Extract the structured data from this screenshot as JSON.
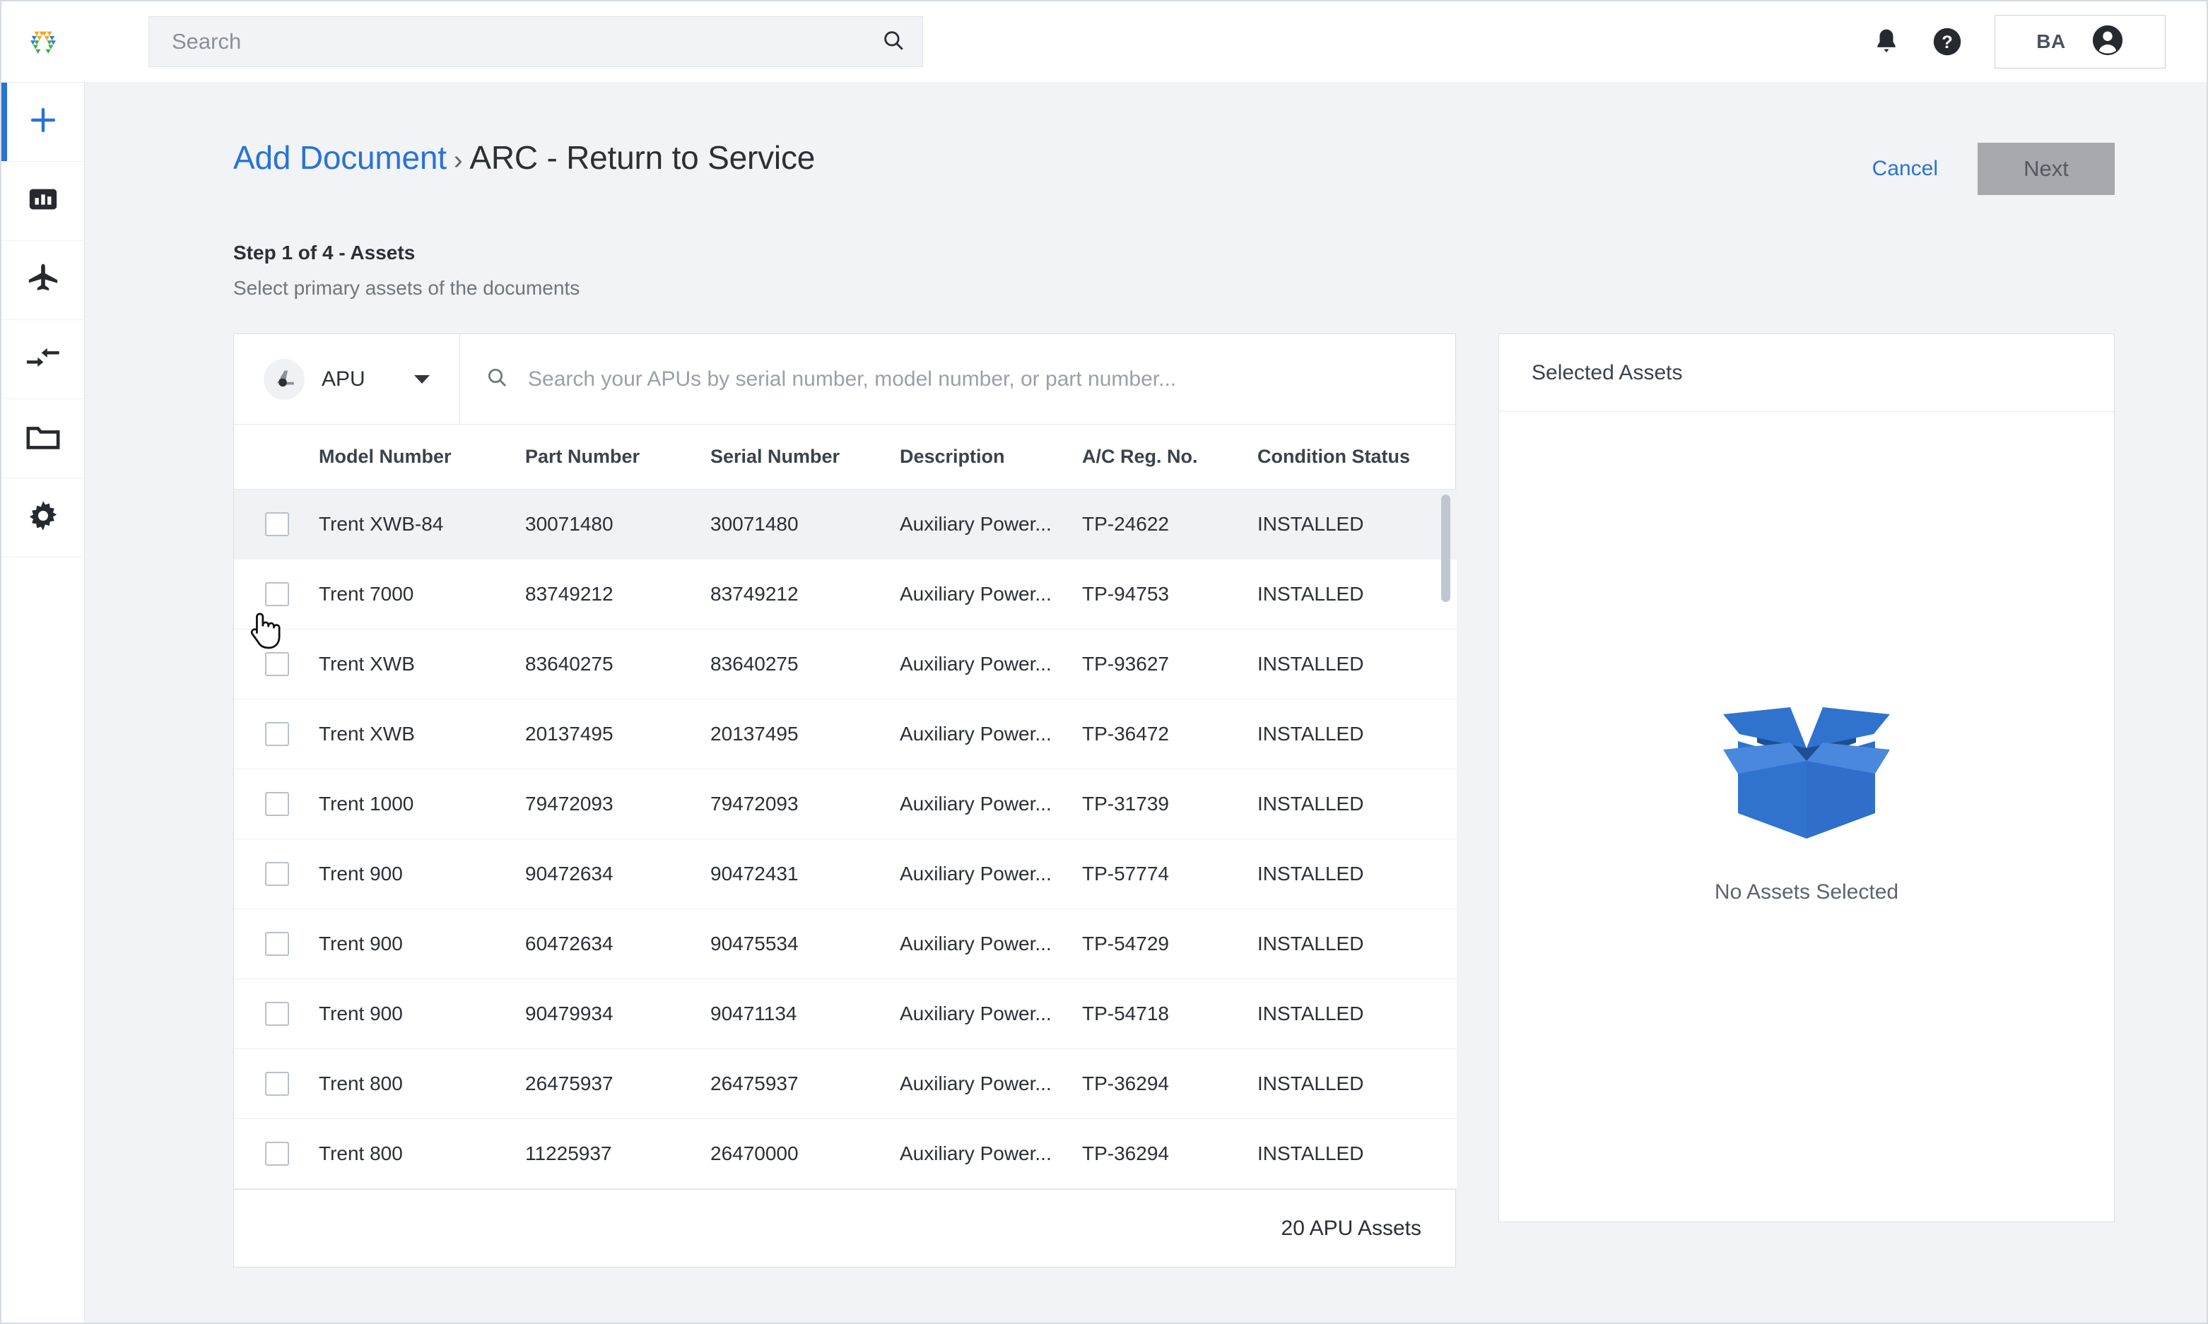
{
  "topbar": {
    "logo_icon": "hexagon-prism-logo",
    "search": {
      "placeholder": "Search",
      "value": "",
      "icon": "search-icon"
    },
    "notifications_icon": "bell-icon",
    "help_icon": "help-circle-icon",
    "user": {
      "initials": "BA",
      "avatar_icon": "account-circle-icon"
    }
  },
  "sidebar": {
    "items": [
      {
        "name": "add",
        "icon": "plus-icon",
        "active": true
      },
      {
        "name": "dashboard",
        "icon": "bar-chart-icon",
        "active": false
      },
      {
        "name": "fleet",
        "icon": "airplane-icon",
        "active": false
      },
      {
        "name": "transfers",
        "icon": "arrows-compress-icon",
        "active": false
      },
      {
        "name": "documents",
        "icon": "folder-icon",
        "active": false
      },
      {
        "name": "settings",
        "icon": "gear-icon",
        "active": false
      }
    ]
  },
  "header": {
    "breadcrumb_link": "Add Document",
    "breadcrumb_separator": "›",
    "breadcrumb_current": "ARC - Return to Service",
    "cancel_label": "Cancel",
    "next_label": "Next"
  },
  "step": {
    "title": "Step 1 of 4 - Assets",
    "subtitle": "Select primary assets of the documents"
  },
  "asset_picker": {
    "type_selector": {
      "label": "APU",
      "icon": "apu-turbine-icon",
      "caret_icon": "chevron-down-icon"
    },
    "search": {
      "placeholder": "Search your APUs by serial number, model number, or part number...",
      "value": "",
      "icon": "search-icon"
    },
    "columns": [
      "Model Number",
      "Part Number",
      "Serial Number",
      "Description",
      "A/C Reg. No.",
      "Condition Status"
    ],
    "rows": [
      {
        "model": "Trent XWB-84",
        "part": "30071480",
        "serial": "30071480",
        "description": "Auxiliary Power...",
        "reg": "TP-24622",
        "condition": "INSTALLED",
        "checked": false,
        "hovered": true
      },
      {
        "model": "Trent 7000",
        "part": "83749212",
        "serial": "83749212",
        "description": "Auxiliary Power...",
        "reg": "TP-94753",
        "condition": "INSTALLED",
        "checked": false,
        "hovered": false
      },
      {
        "model": "Trent XWB",
        "part": "83640275",
        "serial": "83640275",
        "description": "Auxiliary Power...",
        "reg": "TP-93627",
        "condition": "INSTALLED",
        "checked": false,
        "hovered": false
      },
      {
        "model": "Trent XWB",
        "part": "20137495",
        "serial": "20137495",
        "description": "Auxiliary Power...",
        "reg": "TP-36472",
        "condition": "INSTALLED",
        "checked": false,
        "hovered": false
      },
      {
        "model": "Trent 1000",
        "part": "79472093",
        "serial": "79472093",
        "description": "Auxiliary Power...",
        "reg": "TP-31739",
        "condition": "INSTALLED",
        "checked": false,
        "hovered": false
      },
      {
        "model": "Trent 900",
        "part": "90472634",
        "serial": "90472431",
        "description": "Auxiliary Power...",
        "reg": "TP-57774",
        "condition": "INSTALLED",
        "checked": false,
        "hovered": false
      },
      {
        "model": "Trent 900",
        "part": "60472634",
        "serial": "90475534",
        "description": "Auxiliary Power...",
        "reg": "TP-54729",
        "condition": "INSTALLED",
        "checked": false,
        "hovered": false
      },
      {
        "model": "Trent 900",
        "part": "90479934",
        "serial": "90471134",
        "description": "Auxiliary Power...",
        "reg": "TP-54718",
        "condition": "INSTALLED",
        "checked": false,
        "hovered": false
      },
      {
        "model": "Trent 800",
        "part": "26475937",
        "serial": "26475937",
        "description": "Auxiliary Power...",
        "reg": "TP-36294",
        "condition": "INSTALLED",
        "checked": false,
        "hovered": false
      },
      {
        "model": "Trent 800",
        "part": "11225937",
        "serial": "26470000",
        "description": "Auxiliary Power...",
        "reg": "TP-36294",
        "condition": "INSTALLED",
        "checked": false,
        "hovered": false
      }
    ],
    "footer_count": "20 APU Assets"
  },
  "selected_assets": {
    "title": "Selected Assets",
    "empty_text": "No Assets Selected",
    "empty_icon": "open-box-illustration"
  },
  "colors": {
    "accent_blue": "#2a72d6",
    "page_bg": "#f1f3f6",
    "panel_bg": "#ffffff",
    "row_hover": "#f0f2f6",
    "disabled_button": "#a6a9ad",
    "box_blue": "#3073cf",
    "box_blue_light": "#4a88de",
    "box_blue_dark": "#1d4f93"
  }
}
